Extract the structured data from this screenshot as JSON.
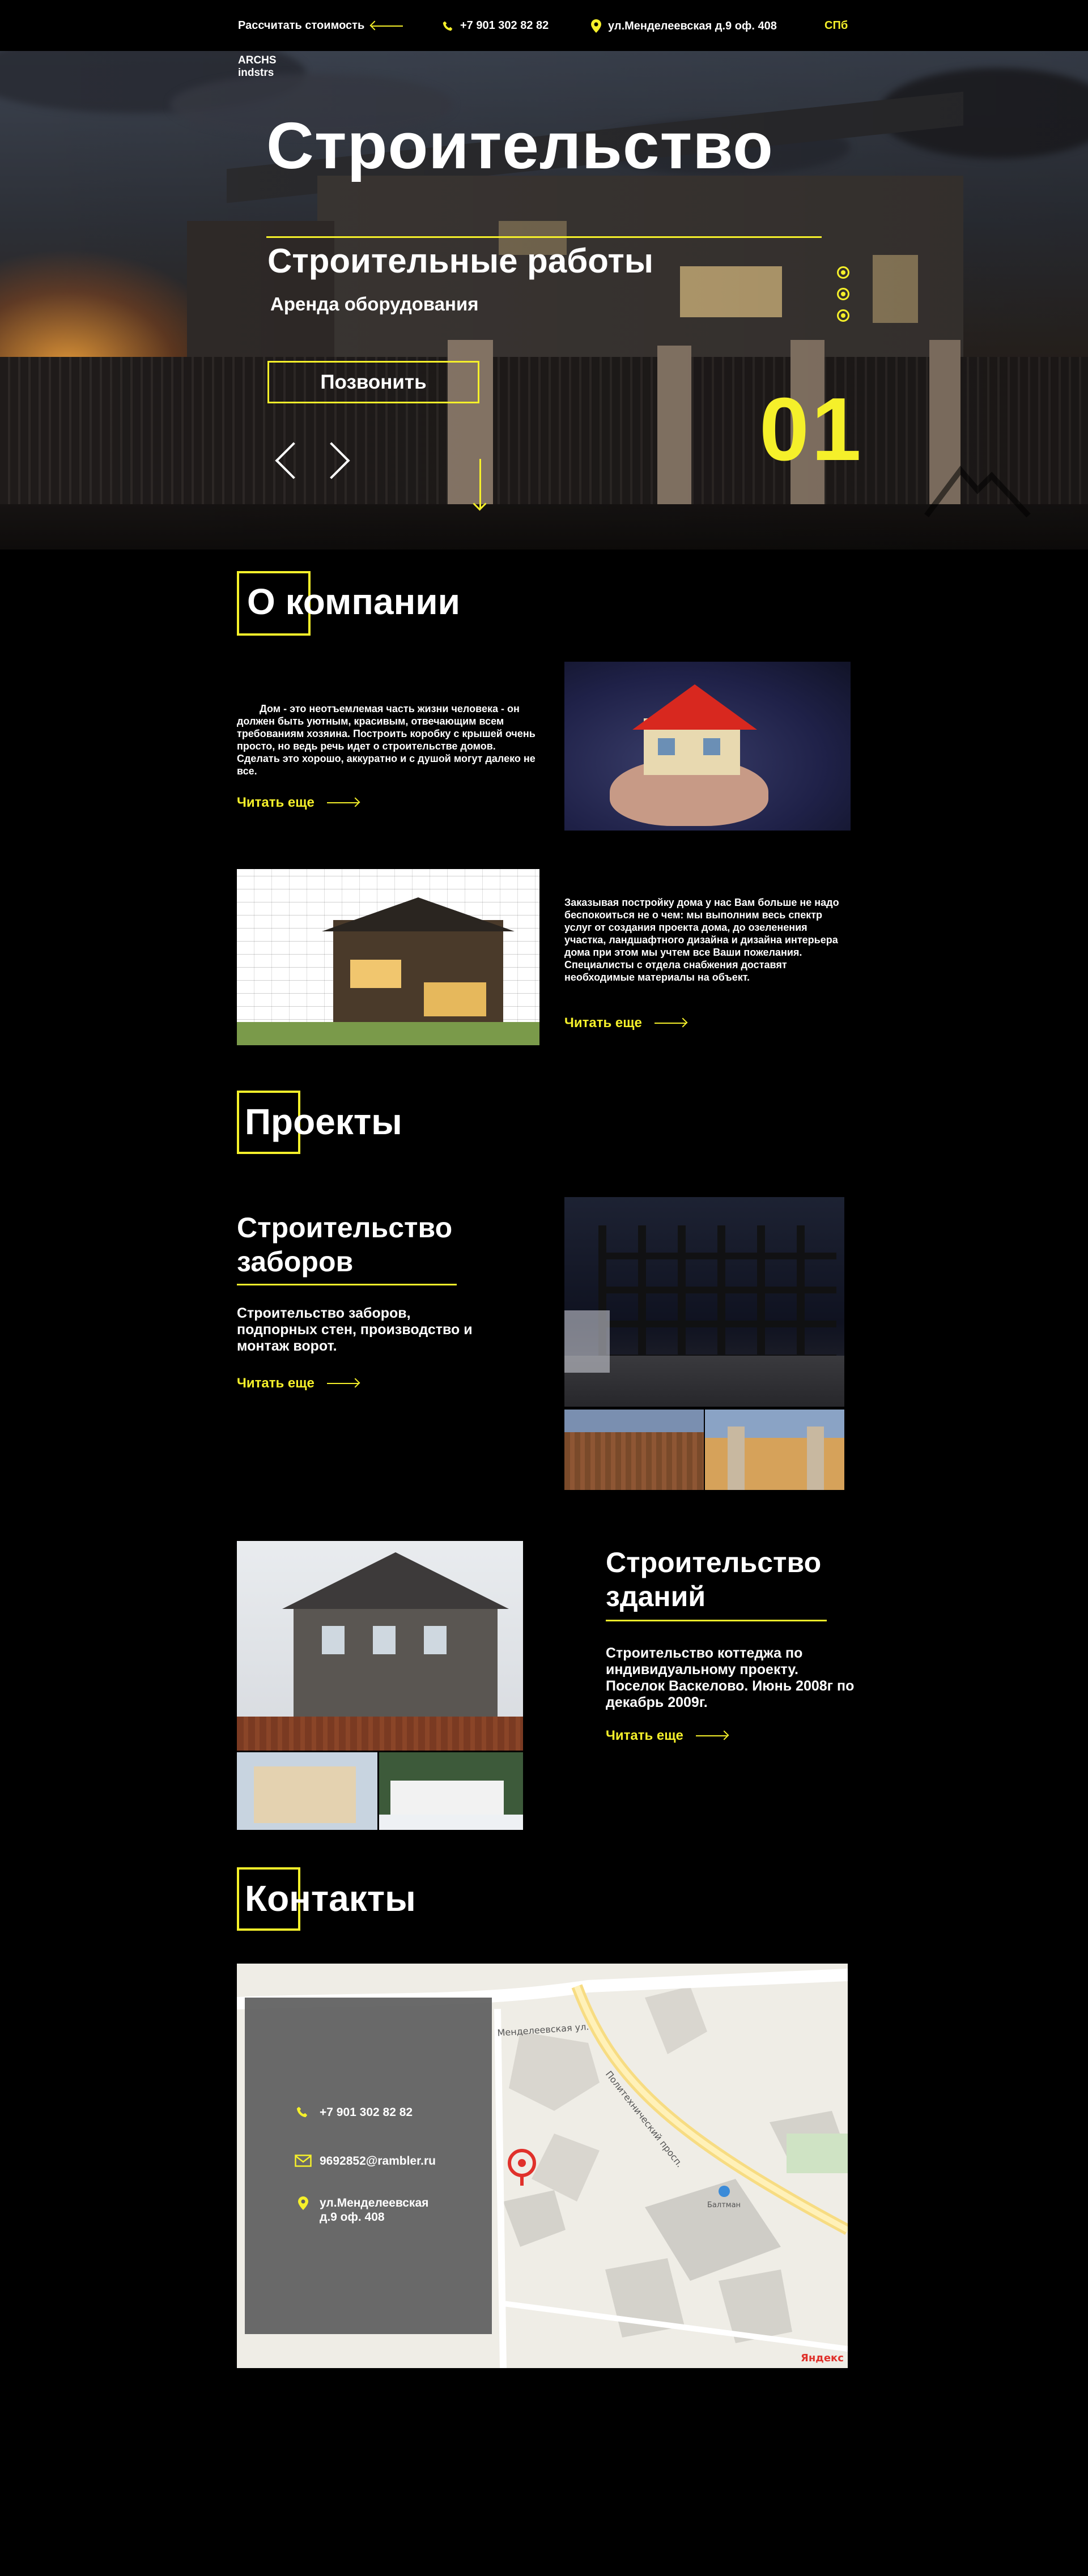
{
  "topbar": {
    "calc_label": "Рассчитать стоимость",
    "phone": "+7 901 302 82 82",
    "address": "ул.Менделеевская д.9 оф. 408",
    "city": "СПб"
  },
  "hero": {
    "logo_line1": "ARCHS",
    "logo_line2": "indstrs",
    "title": "Строительство",
    "subtitle": "Строительные работы",
    "subtitle2": "Аренда оборудования",
    "call_button": "Позвонить",
    "slide_number": "01"
  },
  "about": {
    "heading": "О компании",
    "text1": "Дом - это неотъемлемая часть жизни человека - он должен быть уютным, красивым, отвечающим всем требованиям хозяина. Построить коробку с крышей очень просто, но ведь речь идет о строительстве домов. Сделать это хорошо, аккуратно и с душой могут далеко не все.",
    "text2": "Заказывая постройку дома у нас Вам больше не надо беспокоиться не о чем: мы выполним весь спектр услуг от создания проекта дома, до озеленения участка, ландшафтного дизайна и дизайна интерьера дома при этом мы учтем все Ваши пожелания. Специалисты с отдела снабжения доставят необходимые материалы на объект.",
    "read_more1": "Читать еще",
    "read_more2": "Читать еще"
  },
  "projects": {
    "heading": "Проекты",
    "items": [
      {
        "title_line1": "Строительство",
        "title_line2": "заборов",
        "text": "Строительство заборов, подпорных стен, производство и монтаж ворот.",
        "read_more": "Читать еще"
      },
      {
        "title_line1": "Строительство",
        "title_line2": "зданий",
        "text": "Строительство коттеджа по индивидуальному проекту. Поселок Васкелово. Июнь 2008г по декабрь 2009г.",
        "read_more": "Читать еще"
      }
    ]
  },
  "contacts": {
    "heading": "Контакты",
    "phone": "+7 901 302 82 82",
    "email": "9692852@rambler.ru",
    "address_line1": "ул.Менделеевская",
    "address_line2": "д.9 оф. 408",
    "map_street1": "Менделеевская ул.",
    "map_street2": "Политехнический просп.",
    "map_place": "Балтман",
    "map_brand": "Яндекс"
  },
  "colors": {
    "accent": "#f5f02a",
    "background": "#000000"
  }
}
